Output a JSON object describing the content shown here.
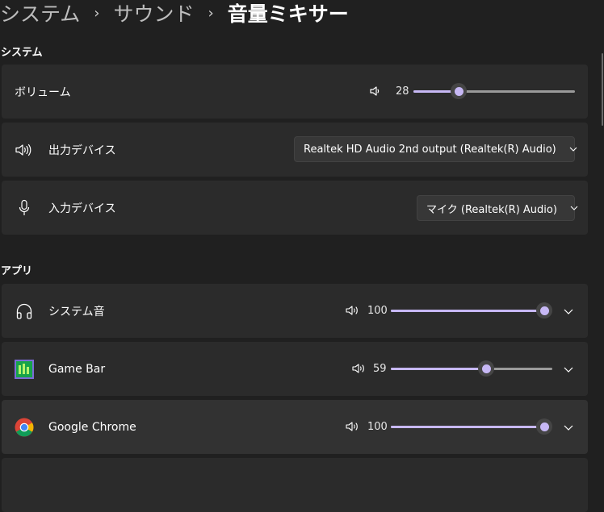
{
  "breadcrumb": {
    "items": [
      "システム",
      "サウンド",
      "音量ミキサー"
    ],
    "separator": "›"
  },
  "sections": {
    "system_title": "システム",
    "apps_title": "アプリ"
  },
  "system": {
    "volume": {
      "label": "ボリューム",
      "value": "28",
      "level": 0.28,
      "icon": "speaker-icon"
    },
    "output": {
      "label": "出力デバイス",
      "selected": "Realtek HD Audio 2nd output (Realtek(R) Audio)",
      "icon": "speaker-loud-icon"
    },
    "input": {
      "label": "入力デバイス",
      "selected": "マイク (Realtek(R) Audio)",
      "icon": "microphone-icon"
    }
  },
  "apps": [
    {
      "name": "システム音",
      "value": "100",
      "level": 1.0,
      "icon": "headphones-icon"
    },
    {
      "name": "Game Bar",
      "value": "59",
      "level": 0.59,
      "icon": "game-bar-icon"
    },
    {
      "name": "Google Chrome",
      "value": "100",
      "level": 1.0,
      "icon": "chrome-icon"
    }
  ],
  "colors": {
    "accent": "#c7b8f5",
    "background": "#202020",
    "card": "#2b2b2b"
  }
}
